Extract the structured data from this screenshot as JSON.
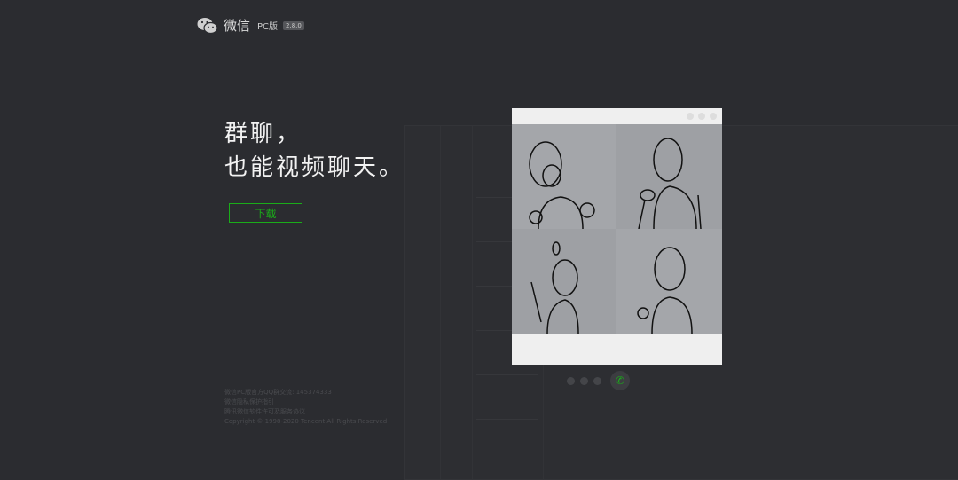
{
  "header": {
    "app_name": "微信",
    "edition": "PC版",
    "version": "2.8.0",
    "logo_icon": "wechat-logo-icon"
  },
  "hero": {
    "line1": "群聊，",
    "line2": "也能视频聊天。",
    "download_label": "下载"
  },
  "footer": {
    "lines": [
      "微信PC版官方QQ群交流: 145374333",
      "微信隐私保护指引",
      "腾讯微信软件许可及服务协议",
      "Copyright © 1998-2020 Tencent All Rights Reserved"
    ]
  },
  "call": {
    "icon": "phone-icon",
    "accent": "#1aad19"
  }
}
